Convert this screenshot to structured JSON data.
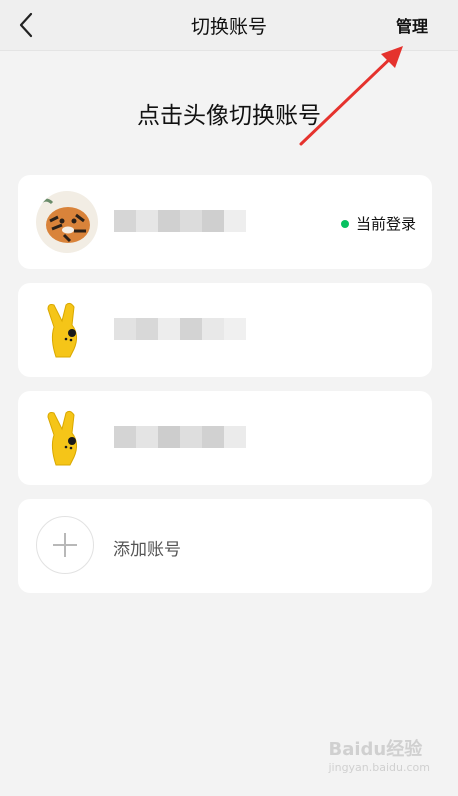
{
  "header": {
    "title": "切换账号",
    "manage_label": "管理"
  },
  "main": {
    "heading": "点击头像切换账号",
    "accounts": [
      {
        "status": "当前登录",
        "avatar": "tiger-avatar"
      },
      {
        "avatar": "yellow-glove-avatar"
      },
      {
        "avatar": "yellow-glove-avatar"
      }
    ],
    "add_account_label": "添加账号"
  },
  "watermark": {
    "brand": "Baidu经验",
    "url": "jingyan.baidu.com"
  },
  "colors": {
    "background": "#f3f3f3",
    "card": "#ffffff",
    "status_dot": "#07c160",
    "annotation_arrow": "#e5322d"
  }
}
